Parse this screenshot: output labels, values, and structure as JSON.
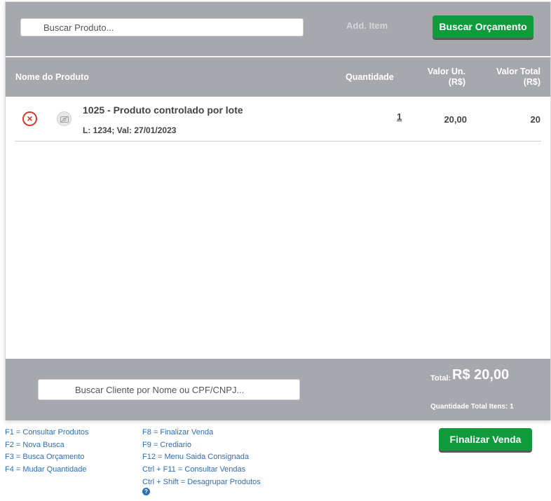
{
  "search": {
    "placeholder": "Buscar Produto..."
  },
  "toolbar": {
    "add_item": "Add. Item",
    "buscar_orcamento": "Buscar Orçamento"
  },
  "table": {
    "headers": {
      "name": "Nome do Produto",
      "quantity": "Quantidade",
      "unit_value_line1": "Valor Un.",
      "unit_value_line2": "(R$)",
      "total_value_line1": "Valor Total",
      "total_value_line2": "(R$)"
    },
    "rows": [
      {
        "name": "1025 - Produto controlado por lote",
        "lot": "L: 1234; Val: 27/01/2023",
        "quantity": "1",
        "unit_value": "20,00",
        "total_value": "20"
      }
    ]
  },
  "footer": {
    "cliente_placeholder": "Buscar Cliente por Nome ou CPF/CNPJ...",
    "total_label": "Total:",
    "total_value": "R$ 20,00",
    "qtd_total": "Quantidade Total Itens: 1"
  },
  "shortcuts": {
    "col1": [
      "F1 = Consultar Produtos",
      "F2 = Nova Busca",
      "F3 = Busca Orçamento",
      "F4 = Mudar Quantidade"
    ],
    "col2": [
      "F8 = Finalizar Venda",
      "F9 = Crediario",
      "F12 = Menu Saida Consignada",
      "Ctrl + F11 = Consultar Vendas",
      "Ctrl + Shift = Desagrupar Produtos"
    ],
    "help_glyph": "?"
  },
  "actions": {
    "finalizar_venda": "Finalizar Venda"
  },
  "colors": {
    "bar_gray": "#a7a8ad",
    "green": "#0f9a3c",
    "link_blue": "#2f6db5",
    "remove_red": "#d9342c"
  }
}
